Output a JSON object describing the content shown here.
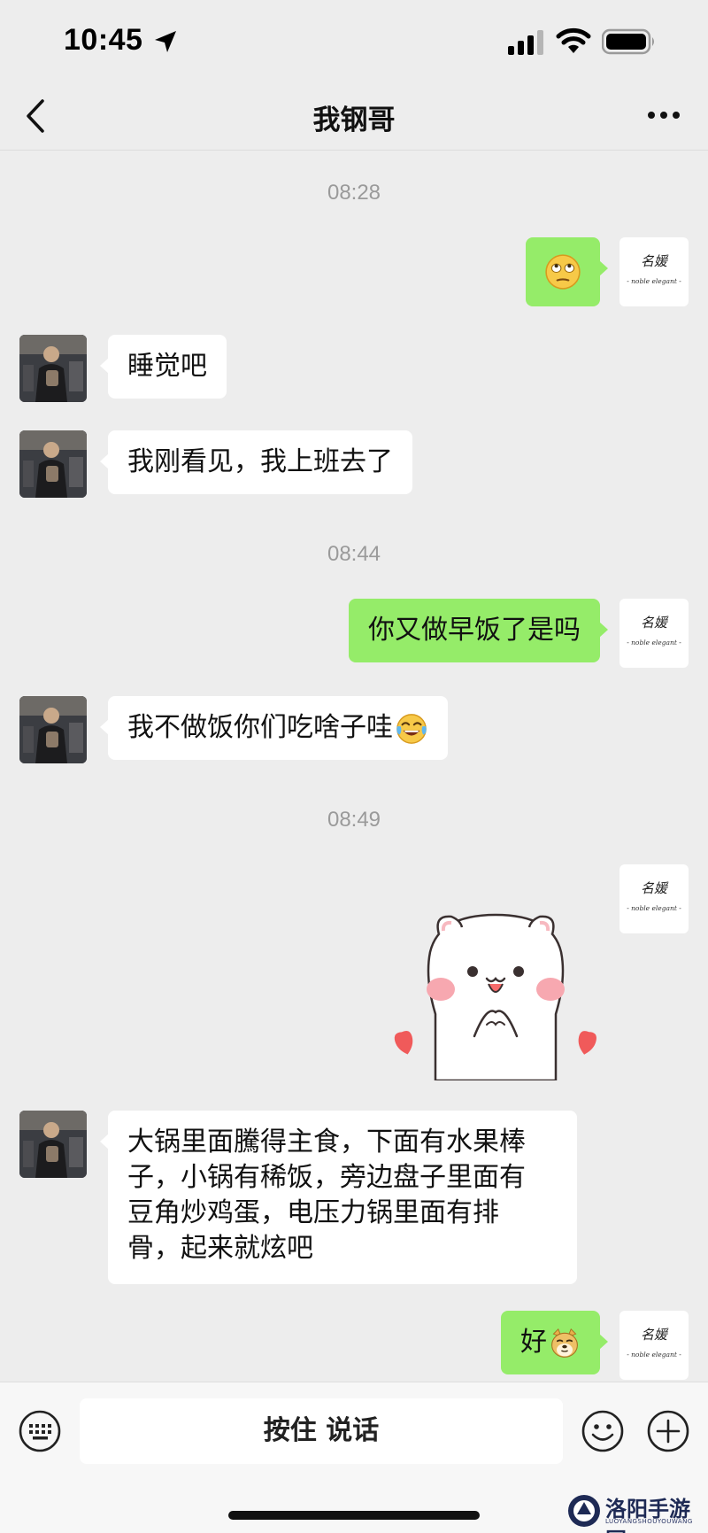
{
  "status_bar": {
    "time": "10:45"
  },
  "nav": {
    "title": "我钢哥"
  },
  "timestamps": [
    "08:28",
    "08:44",
    "08:49"
  ],
  "self_avatar": {
    "line1": "名媛",
    "line2": "- noble elegant -"
  },
  "messages": [
    {
      "side": "out",
      "text": "",
      "emoji": "rolling-eyes-emoji"
    },
    {
      "side": "in",
      "text": "睡觉吧"
    },
    {
      "side": "in",
      "text": "我刚看见，我上班去了"
    },
    {
      "side": "out",
      "text": "你又做早饭了是吗"
    },
    {
      "side": "in",
      "text": "我不做饭你们吃啥子哇",
      "emoji": "tears-of-joy-emoji"
    },
    {
      "side": "out",
      "sticker": "cat-hands-hearts-sticker"
    },
    {
      "side": "in",
      "lines": [
        "大锅里面騰得主食，下面有水果棒",
        "子，小锅有稀饭，旁边盘子里面有",
        "豆角炒鸡蛋，电压力锅里面有排",
        "骨，起来就炫吧"
      ]
    },
    {
      "side": "out",
      "text": "好",
      "emoji": "doge-emoji"
    }
  ],
  "input_bar": {
    "talk_label": "按住 说话"
  },
  "watermark": {
    "name": "洛阳手游网",
    "sub": "LUOYANGSHOUYOUWANG"
  },
  "colors": {
    "background": "#ededed",
    "outgoing_bubble": "#95ec69",
    "incoming_bubble": "#ffffff"
  }
}
